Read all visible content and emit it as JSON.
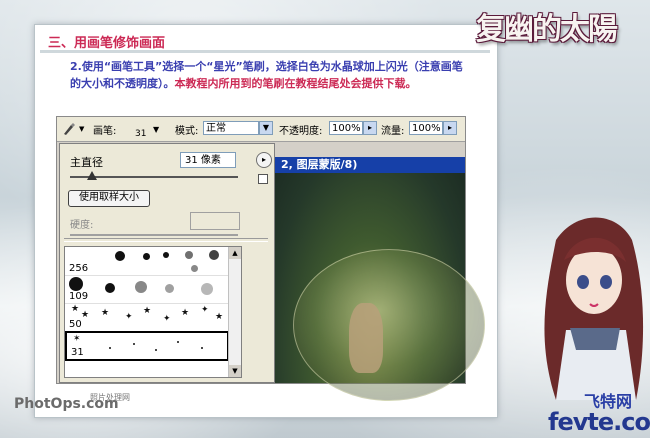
{
  "section_title": "三、用画笔修饰画面",
  "description": {
    "part1": "2.使用“画笔工具”选择一个“星光”笔刷，选择白色为水晶球加上闪光（注意画笔的大小和不透明度）。",
    "part2": "本教程内所用到的笔刷在教程结尾处会提供下载。"
  },
  "logo_title": "复幽的太陽",
  "options_bar": {
    "brush_label": "画笔:",
    "brush_size": "31",
    "mode_label": "模式:",
    "mode_value": "正常",
    "opacity_label": "不透明度:",
    "opacity_value": "100%",
    "flow_label": "流量:",
    "flow_value": "100%"
  },
  "brush_popup": {
    "diameter_label": "主直径",
    "diameter_value": "31 像素",
    "reset_button": "使用取样大小",
    "hardness_label": "硬度:",
    "diameter_fraction": 0.13,
    "presets": [
      {
        "size": "256"
      },
      {
        "size": "109"
      },
      {
        "size": "50"
      },
      {
        "size": "31",
        "selected": true
      }
    ]
  },
  "document": {
    "title": "2, 图层蒙版/8)"
  },
  "watermark": {
    "photops": "PhotOps.com",
    "photops_sub": "照片处理网",
    "fevte_cn": "飞特网",
    "fevte": "fevte.com"
  }
}
